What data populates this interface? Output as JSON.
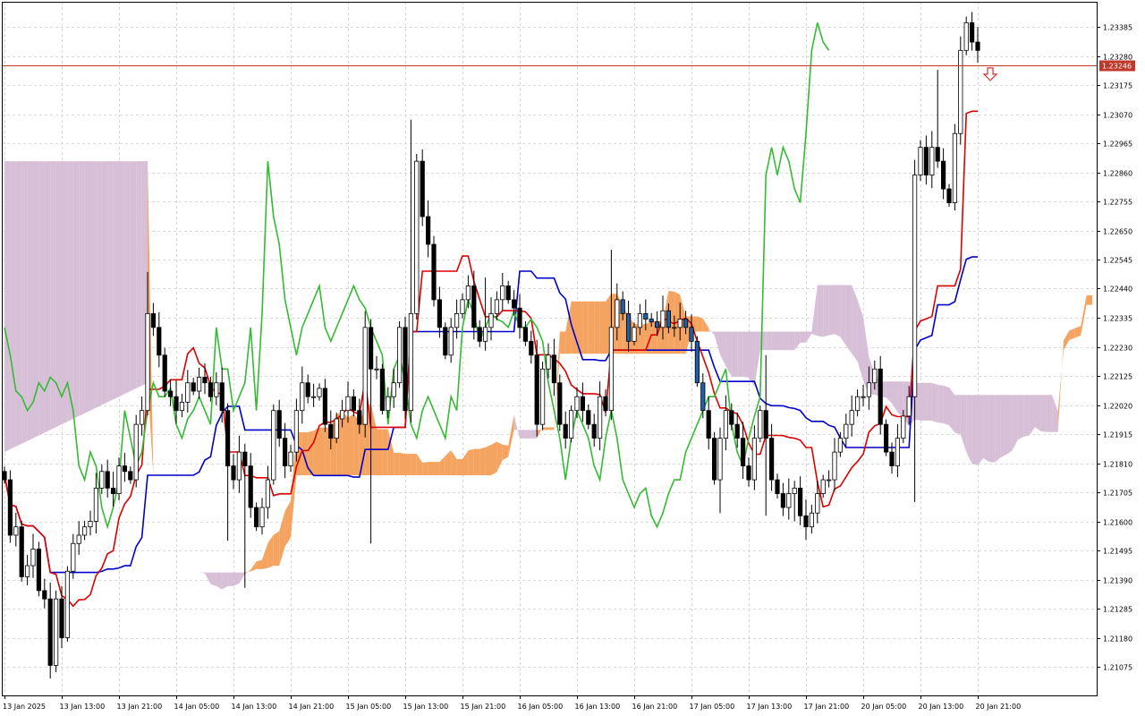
{
  "chart_data": {
    "type": "candlestick",
    "indicator": "Ichimoku Kinko Hyo",
    "y_axis": {
      "ylim": [
        1.21,
        1.235
      ],
      "tick_labels": [
        "1.23385",
        "1.23280",
        "1.23175",
        "1.23070",
        "1.22965",
        "1.22860",
        "1.22755",
        "1.22650",
        "1.22545",
        "1.22440",
        "1.22335",
        "1.22230",
        "1.22125",
        "1.22020",
        "1.21915",
        "1.21810",
        "1.21705",
        "1.21600",
        "1.21495",
        "1.21390",
        "1.21285",
        "1.21180",
        "1.21075"
      ]
    },
    "x_axis": {
      "tick_labels": [
        "13 Jan 2025",
        "13 Jan 13:00",
        "13 Jan 21:00",
        "14 Jan 05:00",
        "14 Jan 13:00",
        "14 Jan 21:00",
        "15 Jan 05:00",
        "15 Jan 13:00",
        "15 Jan 21:00",
        "16 Jan 05:00",
        "16 Jan 13:00",
        "16 Jan 21:00",
        "17 Jan 05:00",
        "17 Jan 13:00",
        "17 Jan 21:00",
        "20 Jan 05:00",
        "20 Jan 13:00",
        "20 Jan 21:00"
      ]
    },
    "current_price": {
      "value": 1.23246,
      "label": "1.23246",
      "color": "#c0392b"
    },
    "signal": {
      "type": "sell-arrow",
      "color": "#e03030"
    },
    "grid": true,
    "candle_colors": {
      "bull": "#ffffff",
      "bear": "#000000",
      "highlight": "#1f5fa6"
    },
    "closes": [
      1.2175,
      1.2155,
      1.2158,
      1.214,
      1.2144,
      1.215,
      1.2135,
      1.2132,
      1.2108,
      1.2132,
      1.2118,
      1.2142,
      1.2152,
      1.2155,
      1.2158,
      1.216,
      1.2172,
      1.2178,
      1.2172,
      1.217,
      1.218,
      1.2178,
      1.2175,
      1.2195,
      1.22,
      1.2235,
      1.223,
      1.222,
      1.2207,
      1.2205,
      1.22,
      1.2203,
      1.221,
      1.2207,
      1.2212,
      1.221,
      1.2205,
      1.221,
      1.22,
      1.218,
      1.2175,
      1.2185,
      1.218,
      1.2165,
      1.2158,
      1.2165,
      1.2175,
      1.22,
      1.219,
      1.218,
      1.2185,
      1.22,
      1.221,
      1.2205,
      1.2205,
      1.2208,
      1.2195,
      1.219,
      1.2197,
      1.22,
      1.2205,
      1.22,
      1.2195,
      1.223,
      1.2215,
      1.2215,
      1.22,
      1.2205,
      1.221,
      1.223,
      1.22,
      1.2235,
      1.229,
      1.227,
      1.226,
      1.224,
      1.223,
      1.222,
      1.223,
      1.2235,
      1.224,
      1.2245,
      1.223,
      1.2225,
      1.223,
      1.2235,
      1.224,
      1.2245,
      1.224,
      1.2237,
      1.223,
      1.2225,
      1.222,
      1.2195,
      1.2215,
      1.222,
      1.221,
      1.2195,
      1.219,
      1.22,
      1.2205,
      1.22,
      1.2195,
      1.219,
      1.2205,
      1.22,
      1.223,
      1.224,
      1.2235,
      1.2225,
      1.223,
      1.2235,
      1.2233,
      1.2232,
      1.223,
      1.2236,
      1.223,
      1.223,
      1.2233,
      1.223,
      1.2225,
      1.221,
      1.22,
      1.219,
      1.2175,
      1.219,
      1.22,
      1.2195,
      1.219,
      1.218,
      1.2175,
      1.219,
      1.22,
      1.219,
      1.2175,
      1.217,
      1.2165,
      1.217,
      1.2172,
      1.2162,
      1.2158,
      1.2163,
      1.217,
      1.2175,
      1.2175,
      1.2185,
      1.219,
      1.2195,
      1.22,
      1.2205,
      1.2205,
      1.221,
      1.2215,
      1.2195,
      1.2185,
      1.218,
      1.219,
      1.2198,
      1.2205,
      1.2285,
      1.2295,
      1.2285,
      1.2295,
      1.229,
      1.228,
      1.2275,
      1.23,
      1.233,
      1.234,
      1.2333,
      1.233
    ]
  }
}
